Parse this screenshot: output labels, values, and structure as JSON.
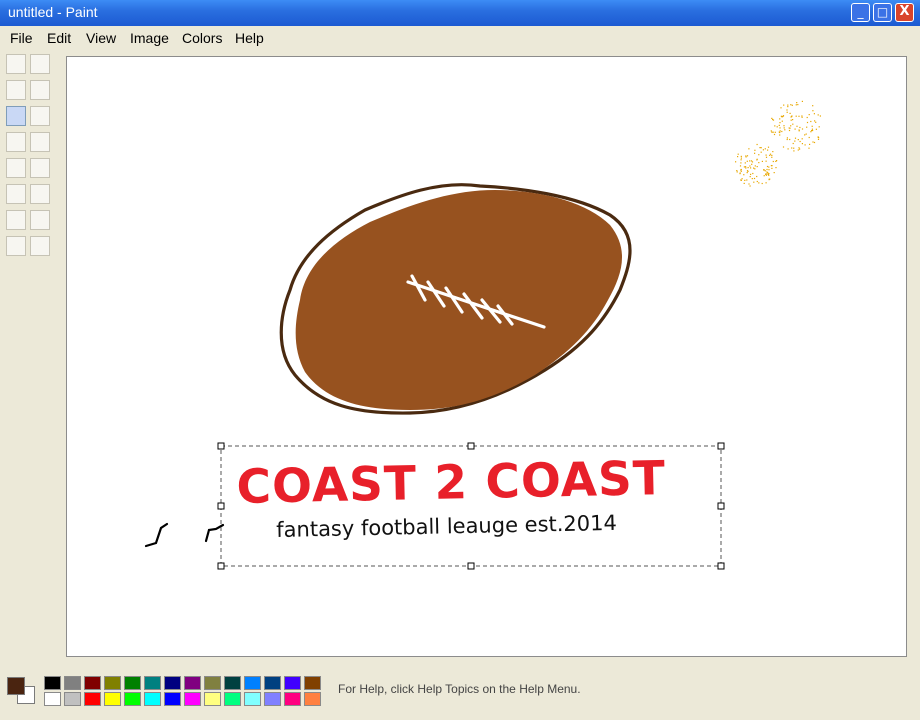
{
  "window": {
    "title": "untitled - Paint",
    "min_label": "_",
    "max_label": "□",
    "close_label": "X"
  },
  "menu": [
    "File",
    "Edit",
    "View",
    "Image",
    "Colors",
    "Help"
  ],
  "toolbox": {
    "rows": 8,
    "cols": 2,
    "active_index": 4
  },
  "canvas": {
    "title_text": "COAST 2 COAST",
    "subtitle_text": "fantasy football leauge est.2014",
    "football_color": "#97521f",
    "outline_color": "#4a2a10",
    "title_color": "#e8202a",
    "spray_color": "#e8a800"
  },
  "colors": {
    "foreground": "#4a2410",
    "background": "#ffffff",
    "palette_top": [
      "#000000",
      "#808080",
      "#800000",
      "#808000",
      "#008000",
      "#008080",
      "#000080",
      "#800080",
      "#808040",
      "#004040",
      "#0080ff",
      "#004080",
      "#4000ff",
      "#804000"
    ],
    "palette_bottom": [
      "#ffffff",
      "#c0c0c0",
      "#ff0000",
      "#ffff00",
      "#00ff00",
      "#00ffff",
      "#0000ff",
      "#ff00ff",
      "#ffff80",
      "#00ff80",
      "#80ffff",
      "#8080ff",
      "#ff0080",
      "#ff8040"
    ]
  },
  "status": {
    "text": "For Help, click Help Topics on the Help Menu."
  }
}
